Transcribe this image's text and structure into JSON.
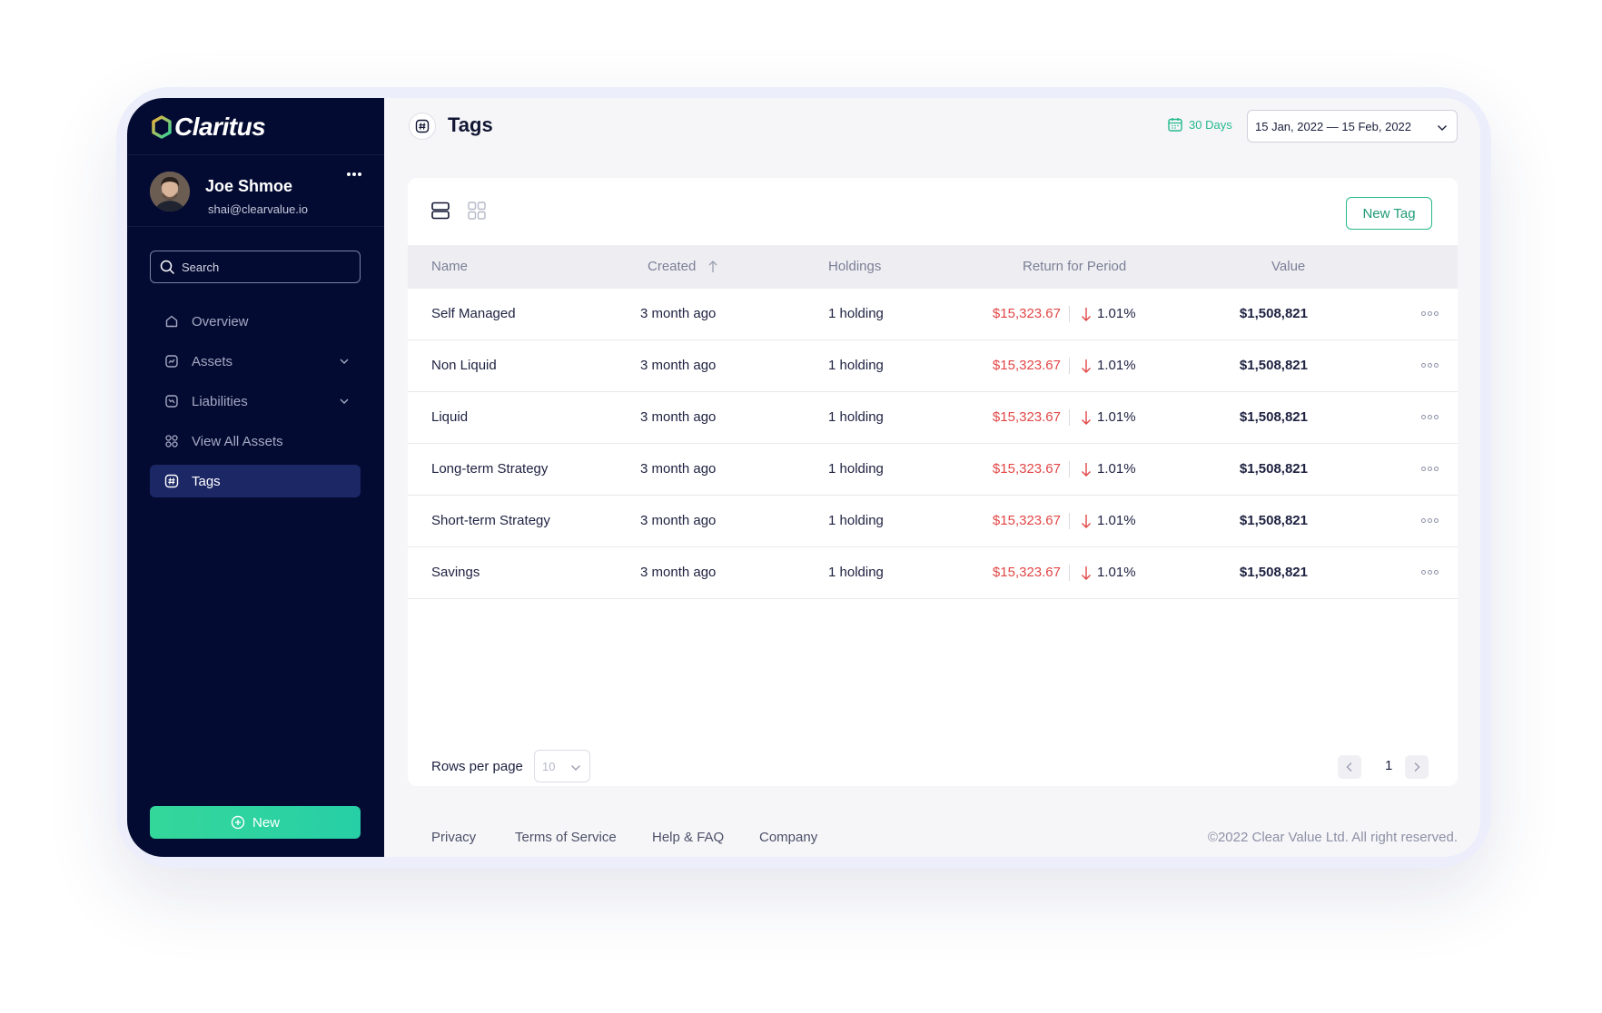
{
  "app": {
    "name": "Claritus"
  },
  "user": {
    "name": "Joe Shmoe",
    "email": "shai@clearvalue.io"
  },
  "search": {
    "placeholder": "Search"
  },
  "sidebar": {
    "items": [
      {
        "label": "Overview",
        "icon": "home-icon"
      },
      {
        "label": "Assets",
        "icon": "chart-icon"
      },
      {
        "label": "Liabilities",
        "icon": "liabilities-icon"
      },
      {
        "label": "View All Assets",
        "icon": "grid-icon"
      },
      {
        "label": "Tags",
        "icon": "hash-icon"
      }
    ],
    "new_label": "New"
  },
  "header": {
    "title": "Tags",
    "period_label": "30 Days",
    "date_range": "15 Jan, 2022 — 15 Feb, 2022"
  },
  "toolbar": {
    "new_tag_label": "New Tag"
  },
  "table": {
    "columns": [
      "Name",
      "Created",
      "Holdings",
      "Return for Period",
      "Value"
    ],
    "rows": [
      {
        "name": "Self Managed",
        "created": "3 month ago",
        "holdings": "1 holding",
        "return": "$15,323.67",
        "change": "1.01%",
        "value": "$1,508,821"
      },
      {
        "name": "Non Liquid",
        "created": "3 month ago",
        "holdings": "1 holding",
        "return": "$15,323.67",
        "change": "1.01%",
        "value": "$1,508,821"
      },
      {
        "name": "Liquid",
        "created": "3 month ago",
        "holdings": "1 holding",
        "return": "$15,323.67",
        "change": "1.01%",
        "value": "$1,508,821"
      },
      {
        "name": "Long-term Strategy",
        "created": "3 month ago",
        "holdings": "1 holding",
        "return": "$15,323.67",
        "change": "1.01%",
        "value": "$1,508,821"
      },
      {
        "name": "Short-term Strategy",
        "created": "3 month ago",
        "holdings": "1 holding",
        "return": "$15,323.67",
        "change": "1.01%",
        "value": "$1,508,821"
      },
      {
        "name": "Savings",
        "created": "3 month ago",
        "holdings": "1 holding",
        "return": "$15,323.67",
        "change": "1.01%",
        "value": "$1,508,821"
      }
    ]
  },
  "pagination": {
    "rows_label": "Rows per page",
    "rows_value": "10",
    "page": "1"
  },
  "footer": {
    "links": [
      "Privacy",
      "Terms of Service",
      "Help & FAQ",
      "Company"
    ],
    "copyright": "©2022 Clear Value Ltd. All right reserved."
  },
  "colors": {
    "sidebar_bg": "#040b32",
    "accent_green": "#27b98c",
    "negative_red": "#e24646",
    "active_nav": "#1c2766"
  }
}
